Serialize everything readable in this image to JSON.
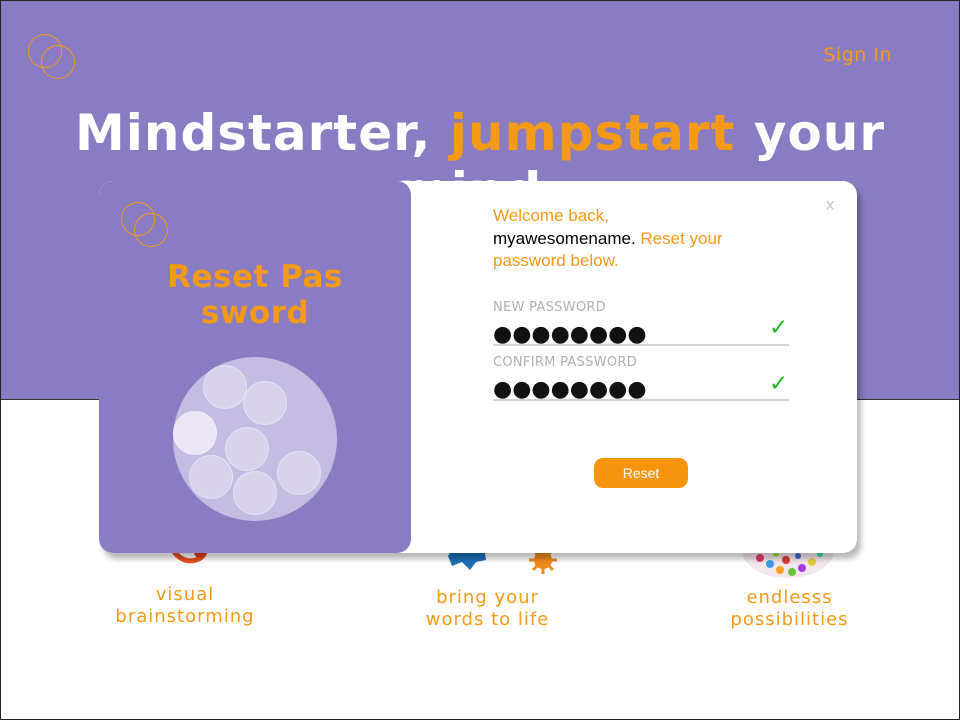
{
  "header": {
    "logo_icon": "intersecting-circles-logo",
    "signin_label": "Sign In",
    "headline_before": "Mindstarter, ",
    "headline_accent": "jumpstart",
    "headline_after": " your mind."
  },
  "features": [
    {
      "line1": "visual",
      "line2": "brainstorming",
      "icon": "swirl-icon"
    },
    {
      "line1": "bring your",
      "line2": "words to life",
      "icon": "gears-icon"
    },
    {
      "line1": "endlesss",
      "line2": "possibilities",
      "icon": "colorful-dots-icon"
    }
  ],
  "modal": {
    "title": "Reset Password",
    "close_label": "x",
    "welcome_part1": "Welcome back,",
    "username": "myawesomename.",
    "welcome_part2": " Reset your password below.",
    "new_password_label": "NEW PASSWORD",
    "new_password_value": "●●●●●●●●",
    "confirm_password_label": "CONFIRM PASSWORD",
    "confirm_password_value": "●●●●●●●●",
    "valid_mark": "✓",
    "reset_button": "Reset"
  },
  "colors": {
    "brand_purple": "#8a7cc2",
    "accent_orange": "#f59a16",
    "valid_green": "#1fb71f"
  }
}
